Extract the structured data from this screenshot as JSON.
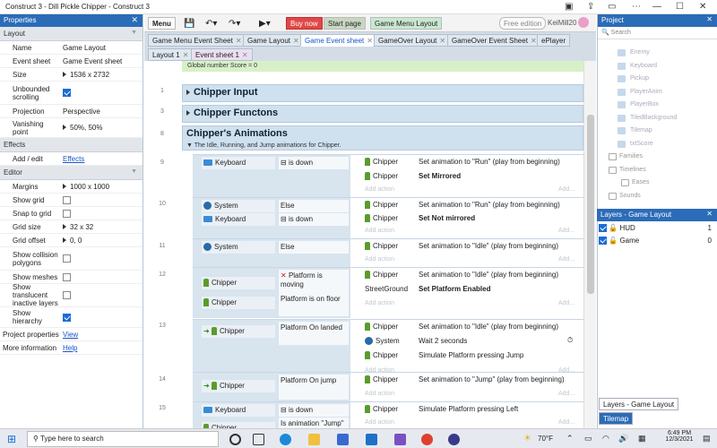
{
  "window": {
    "title": "Construct 3 - Dill Pickle Chipper - Construct 3"
  },
  "properties": {
    "header": "Properties",
    "sections": {
      "layout": "Layout",
      "effects": "Effects",
      "editor": "Editor"
    },
    "rows": {
      "name_k": "Name",
      "name_v": "Game Layout",
      "evsheet_k": "Event sheet",
      "evsheet_v": "Game Event sheet",
      "size_k": "Size",
      "size_v": "1536 x 2732",
      "unb_k": "Unbounded scrolling",
      "proj_k": "Projection",
      "proj_v": "Perspective",
      "van_k": "Vanishing point",
      "van_v": "50%, 50%",
      "addedit_k": "Add / edit",
      "addedit_v": "Effects",
      "margins_k": "Margins",
      "margins_v": "1000 x 1000",
      "showgrid_k": "Show grid",
      "snap_k": "Snap to grid",
      "gridsize_k": "Grid size",
      "gridsize_v": "32 x 32",
      "gridoff_k": "Grid offset",
      "gridoff_v": "0, 0",
      "coll_k": "Show collision polygons",
      "mesh_k": "Show meshes",
      "transl_k": "Show translucent inactive layers",
      "hier_k": "Show hierarchy",
      "projprops_k": "Project properties",
      "projprops_v": "View",
      "moreinfo_k": "More information",
      "moreinfo_v": "Help"
    }
  },
  "toolbar": {
    "menu": "Menu",
    "buy": "Buy now",
    "start": "Start page",
    "gml": "Game Menu Layout",
    "free": "Free edition",
    "user": "KeiMill20"
  },
  "tabs_row1": [
    "Game Menu Event Sheet",
    "Game Layout",
    "Game Event sheet",
    "GameOver Layout",
    "GameOver Event Sheet",
    "ePlayer"
  ],
  "tabs_row2": [
    "Layout 1",
    "Event sheet 1"
  ],
  "global_number": "Global number Score = 0",
  "groups": {
    "g1": "Chipper Input",
    "g1n": "1",
    "g2": "Chipper Functons",
    "g2n": "3",
    "g3": "Chipper's Animations",
    "g3n": "8",
    "g3sub": "The Idle, Running, and Jump animations for Chipper."
  },
  "events": {
    "n9": "9",
    "n10": "10",
    "n11": "11",
    "n12": "12",
    "n13": "13",
    "n14": "14",
    "n15": "15",
    "keyboard": "Keyboard",
    "isdown": "is down",
    "system": "System",
    "else": "Else",
    "chipper": "Chipper",
    "streetground": "StreetGround",
    "platform_moving": "Platform is moving",
    "platform_floor": "Platform is on floor",
    "platform_landed": "Platform On landed",
    "platform_jump": "Platform On jump",
    "is_anim_jump": "Is animation \"Jump\" playing",
    "a_run": "Set animation to \"Run\" (play from beginning)",
    "a_mirrored": "Set Mirrored",
    "a_notmirrored": "Set Not mirrored",
    "a_idle": "Set animation to \"Idle\" (play from beginning)",
    "a_platform_enabled": "Set Platform Enabled",
    "a_wait": "Wait 2 seconds",
    "a_sim_jump": "Simulate Platform pressing Jump",
    "a_jump": "Set animation to \"Jump\" (play from beginning)",
    "a_sim_left": "Simulate Platform pressing Left",
    "add": "Add action",
    "add2": "Add..."
  },
  "project": {
    "header": "Project",
    "search": "Search",
    "items": [
      "Enemy",
      "Keyboard",
      "Pickup",
      "PlayerAnim",
      "PlayerBox",
      "TiledBackground",
      "Tilemap",
      "txtScore"
    ],
    "folders": [
      "Families",
      "Timelines",
      "Eases",
      "Sounds"
    ]
  },
  "layers": {
    "header": "Layers - Game Layout",
    "l1": "HUD",
    "l1n": "1",
    "l2": "Game",
    "l2n": "0",
    "tab1": "Layers - Game Layout",
    "tab2": "Tilemap"
  },
  "taskbar": {
    "search": "Type here to search",
    "temp": "70°F",
    "time": "6:49 PM",
    "date": "12/3/2021"
  }
}
